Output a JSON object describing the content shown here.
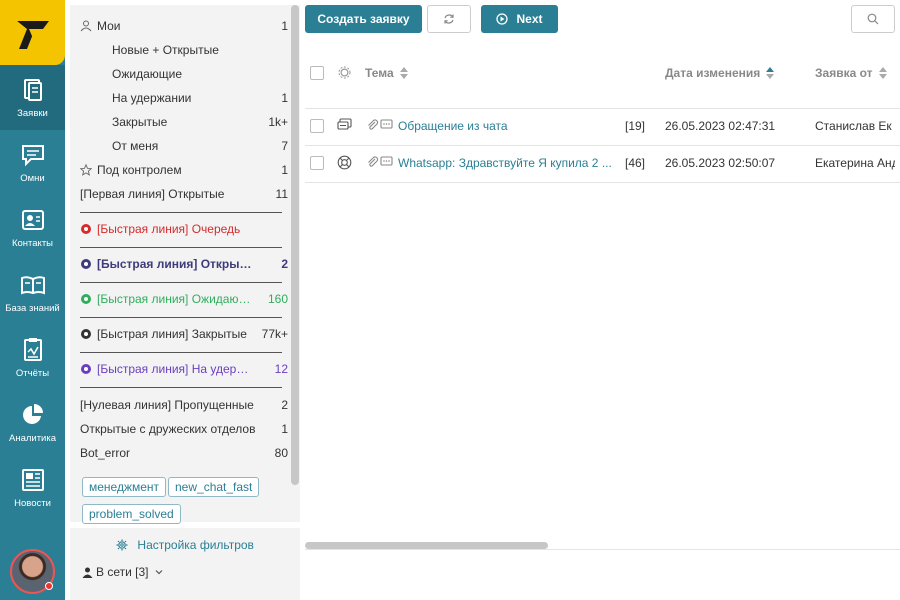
{
  "nav": {
    "items": [
      {
        "label": "Заявки",
        "icon": "tickets-icon"
      },
      {
        "label": "Омни",
        "icon": "chat-icon"
      },
      {
        "label": "Контакты",
        "icon": "contacts-icon"
      },
      {
        "label": "База знаний",
        "icon": "book-icon"
      },
      {
        "label": "Отчёты",
        "icon": "report-icon"
      },
      {
        "label": "Аналитика",
        "icon": "pie-chart-icon"
      },
      {
        "label": "Новости",
        "icon": "news-icon"
      }
    ]
  },
  "filters": {
    "my": {
      "label": "Мои",
      "count": "1"
    },
    "my_sub": [
      {
        "label": "Новые + Открытые",
        "count": ""
      },
      {
        "label": "Ожидающие",
        "count": ""
      },
      {
        "label": "На удержании",
        "count": "1"
      },
      {
        "label": "Закрытые",
        "count": "1k+"
      },
      {
        "label": "От меня",
        "count": "7"
      }
    ],
    "watched": {
      "label": "Под контролем",
      "count": "1"
    },
    "first_line": {
      "label": "[Первая линия] Открытые",
      "count": "11"
    },
    "fast_queue": {
      "label": "[Быстрая линия] Очередь",
      "count": ""
    },
    "fast_open": {
      "label": "[Быстрая линия] Открытые",
      "count": "2"
    },
    "fast_waiting": {
      "label": "[Быстрая линия] Ожидающие",
      "count": "160"
    },
    "fast_closed": {
      "label": "[Быстрая линия] Закрытые",
      "count": "77k+"
    },
    "fast_hold": {
      "label": "[Быстрая линия] На удержании",
      "count": "12"
    },
    "zero_missed": {
      "label": "[Нулевая линия] Пропущенные",
      "count": "2"
    },
    "friendly_open": {
      "label": "Открытые с дружеских отделов",
      "count": "1"
    },
    "bot_error": {
      "label": "Bot_error",
      "count": "80"
    },
    "tags": [
      "менеджмент",
      "new_chat_fast",
      "problem_solved"
    ],
    "setup_label": "Настройка фильтров",
    "online_label": "В сети [3]"
  },
  "toolbar": {
    "create_label": "Создать заявку",
    "next_label": "Next"
  },
  "table": {
    "headers": {
      "subject": "Тема",
      "changed": "Дата изменения",
      "from": "Заявка от"
    },
    "rows": [
      {
        "subject": "Обращение из чата",
        "count": "[19]",
        "changed": "26.05.2023 02:47:31",
        "from": "Станислав Ек",
        "channel_icon": "chat-channel-icon"
      },
      {
        "subject": "Whatsapp: Здравствуйте Я купила 2 ...",
        "count": "[46]",
        "changed": "26.05.2023 02:50:07",
        "from": "Екатерина Анд",
        "channel_icon": "lifebuoy-icon"
      }
    ]
  },
  "colors": {
    "accent": "#2a7f95",
    "logo": "#f5c400",
    "red": "#d52b2b",
    "green": "#2fae5c",
    "purple": "#6a3fbf",
    "navy": "#3f3a7a"
  }
}
